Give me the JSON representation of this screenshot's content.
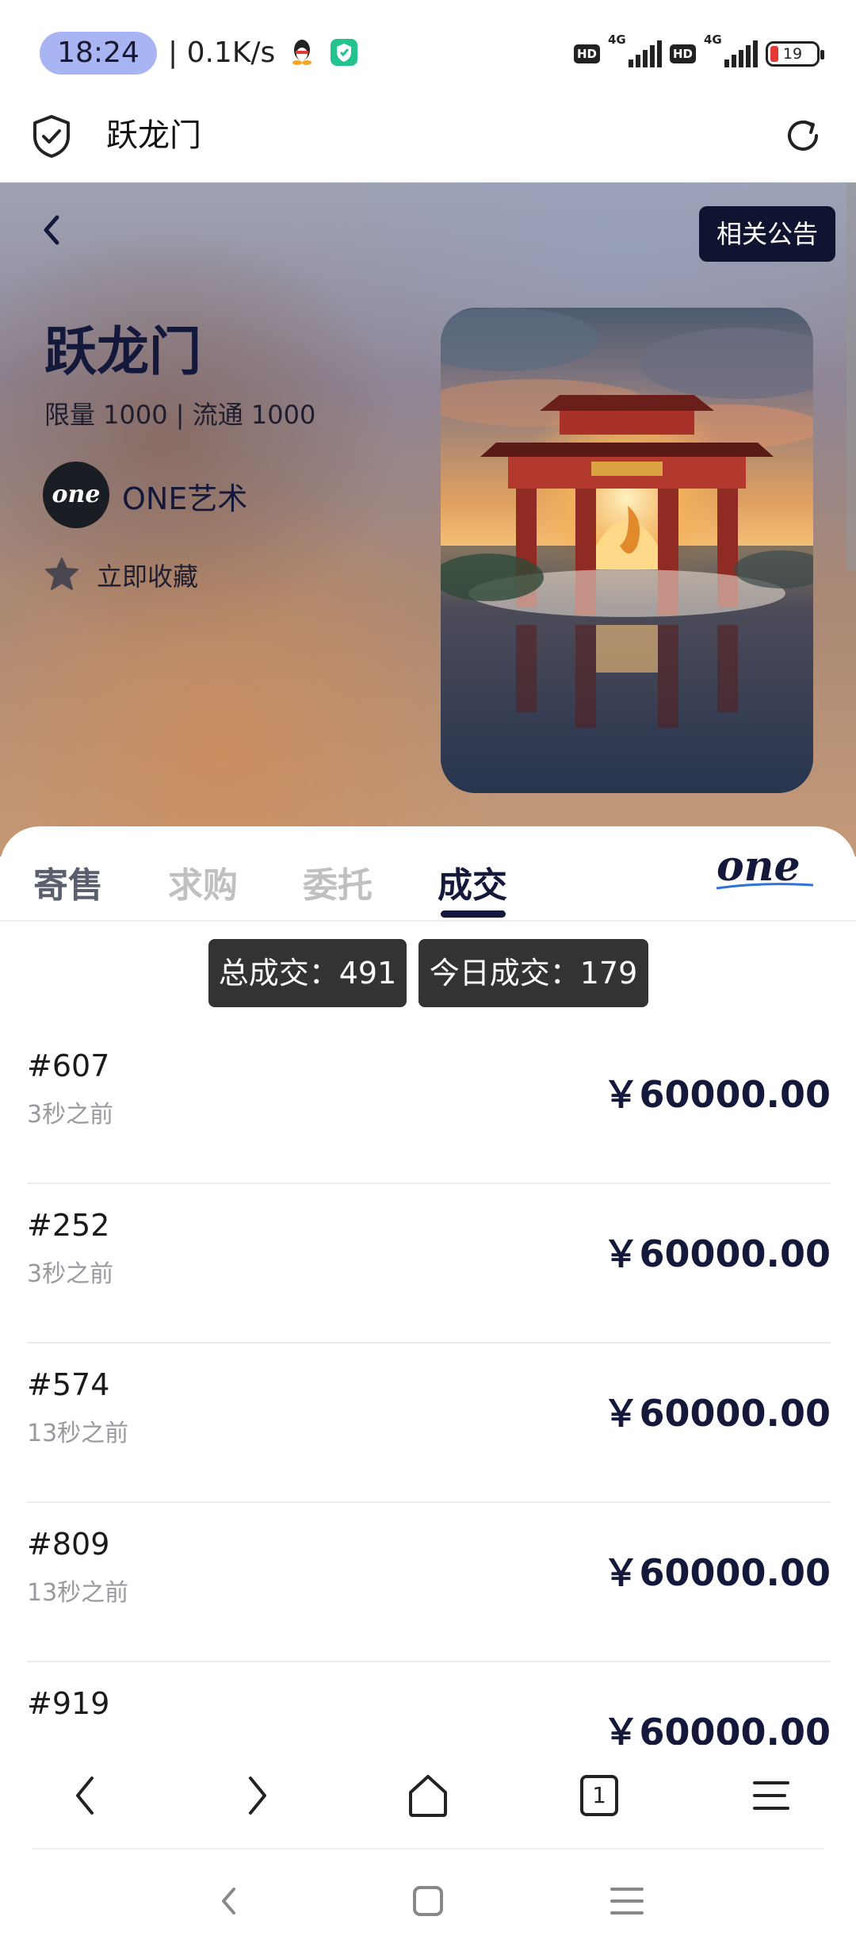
{
  "status_bar": {
    "time": "18:24",
    "net_speed": "| 0.1K/s",
    "sim1_badge": "HD",
    "sim1_net": "4G",
    "sim2_badge": "HD",
    "sim2_net": "4G",
    "battery": "19",
    "battery_color": "#e53935"
  },
  "browser_bar": {
    "title": "跃龙门",
    "shield_icon": "shield-check-icon",
    "refresh_icon": "refresh-icon"
  },
  "hero": {
    "notice_label": "相关公告",
    "title": "跃龙门",
    "supply": "限量 1000 | 流通 1000",
    "creator_avatar": "one",
    "creator_name": "ONE艺术",
    "favorite_label": "立即收藏"
  },
  "tabs": [
    {
      "label": "寄售"
    },
    {
      "label": "求购"
    },
    {
      "label": "委托"
    },
    {
      "label": "成交"
    }
  ],
  "active_tab": "成交",
  "brand_logo": "one",
  "stats": {
    "total": "总成交：491",
    "today": "今日成交：179"
  },
  "trades": [
    {
      "id": "#607",
      "time": "3秒之前",
      "price": "￥60000.00"
    },
    {
      "id": "#252",
      "time": "3秒之前",
      "price": "￥60000.00"
    },
    {
      "id": "#574",
      "time": "13秒之前",
      "price": "￥60000.00"
    },
    {
      "id": "#809",
      "time": "13秒之前",
      "price": "￥60000.00"
    },
    {
      "id": "#919",
      "time": "",
      "price": "￥60000.00"
    }
  ],
  "browser_nav": {
    "tab_count": "1"
  },
  "colors": {
    "accent": "#14183a",
    "stat_bg": "#333333",
    "time_pill": "#a9b4f2"
  }
}
